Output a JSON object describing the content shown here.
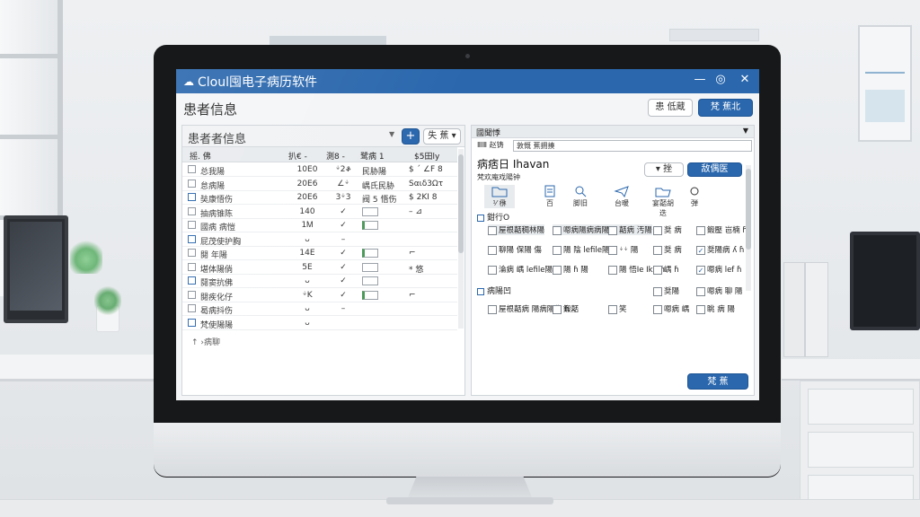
{
  "app": {
    "title": "Cloul囤电子病历软件",
    "logo_icon": "cloud-icon",
    "controls": [
      "—",
      "◎",
      "✕"
    ],
    "accent_color": "#2a67ad"
  },
  "page": {
    "title": "患者信息",
    "btn_secondary": "患 低蔵",
    "btn_primary": "梵 蕉北"
  },
  "left_panel": {
    "header_label": "患者者信息",
    "add_button": "+",
    "filter_button": "失 蕉 ▾",
    "columns": [
      "摇. 佛",
      "扒€ - ",
      "測8 -",
      "鹭病 1",
      "$5田ly"
    ],
    "rows": [
      {
        "name": "总我陽",
        "c1": "10E0",
        "c2": "ᛎ2ቆ",
        "c3": "民胁陽",
        "c4": "$ ˊ ∠F 8",
        "input": false
      },
      {
        "name": "怠病陽",
        "c1": "20E6",
        "c2": "∠ᛎ",
        "c3": "嵎氏民胁",
        "c4": "Sαιδ3Ωτ",
        "input": false
      },
      {
        "name": "奘康悟伤",
        "c1": "20E6",
        "c2": "3ᛎ3",
        "c3": "阀 5 悟伤",
        "c4": "$ 2KI 8",
        "input": false
      },
      {
        "name": "抽病锥陈",
        "c1": "140",
        "c2": "✓",
        "c3": "",
        "c4": "–  ⊿",
        "input": true,
        "green": false
      },
      {
        "name": "國病 病愷",
        "c1": "1Ꮇ",
        "c2": "✓",
        "c3": "",
        "c4": "",
        "input": true,
        "green": true
      },
      {
        "name": "屁茂使护胸",
        "c1": "ᴗ",
        "c2": "–",
        "c3": "",
        "c4": "",
        "input": false
      },
      {
        "name": "閱 年陽",
        "c1": "14E",
        "c2": "✓",
        "c3": "",
        "c4": "⌐",
        "input": true,
        "green": true
      },
      {
        "name": "堪体陽倘",
        "c1": "5E",
        "c2": "✓",
        "c3": "",
        "c4": "* 悠",
        "input": true,
        "green": false
      },
      {
        "name": "鬩窦抗佛",
        "c1": "ᴗ",
        "c2": "✓",
        "c3": "",
        "c4": "",
        "input": true,
        "green": false
      },
      {
        "name": "閱疾化仔",
        "c1": "ᛎK",
        "c2": "✓",
        "c3": "",
        "c4": "⌐",
        "input": true,
        "green": true
      },
      {
        "name": "曷病抖伤",
        "c1": "ᴗ",
        "c2": "–",
        "c3": "",
        "c4": "",
        "input": false
      },
      {
        "name": "梵使陽陽",
        "c1": "ᴗ",
        "c2": "",
        "c3": "",
        "c4": "",
        "input": false
      }
    ],
    "footer": "↑ ›病聊"
  },
  "right_panel": {
    "header_label": "國聞悸",
    "path_label": "ⅢⅢ 赵铸",
    "path_value": "敦慨 蕉拥揍",
    "section_title": "病痞日 Ihavan",
    "section_sub": "梵欢庵戏陽钟",
    "search_button": "▾ 挫",
    "primary_button": "敌偶医",
    "tools": [
      {
        "label": "⅟ 㮊",
        "icon": "folder-icon"
      },
      {
        "label": "百",
        "icon": "document-icon"
      },
      {
        "label": "脚旧",
        "icon": "search-doc-icon"
      },
      {
        "label": "台暖",
        "icon": "send-icon"
      },
      {
        "label": "宴嚭胡 迭",
        "icon": "folder-open-icon"
      },
      {
        "label": "弾",
        "icon": "settings-icon"
      }
    ],
    "group1_label": "鉗行O",
    "group1_options": [
      {
        "label": "屋根嚭稠林陽",
        "checked": false,
        "hl": true
      },
      {
        "label": "嗯病陽病病陽",
        "checked": false,
        "hl": true
      },
      {
        "label": "嚭病 汚陽",
        "checked": false,
        "hl": true
      },
      {
        "label": "奨 病",
        "checked": false,
        "hl": false
      },
      {
        "label": "鍛壓 岜楠 ɦ",
        "checked": false,
        "hl": false
      },
      {
        "label": "聊陽 保陽 傷",
        "checked": false,
        "hl": false
      },
      {
        "label": "陽 陰 lefile陽",
        "checked": false,
        "hl": false
      },
      {
        "label": "ᛎᛎ 陽",
        "checked": false,
        "hl": false
      },
      {
        "label": "奨 病",
        "checked": false,
        "hl": false
      },
      {
        "label": "奨陽病 ʎ ɦ",
        "checked": true,
        "hl": false
      },
      {
        "label": "淪病 嵎 lefile陽",
        "checked": false,
        "hl": false
      },
      {
        "label": "陽 ɦ 陽",
        "checked": false,
        "hl": false
      },
      {
        "label": "陽 悟Ie Ikᴗ ɦ",
        "checked": false,
        "hl": false
      },
      {
        "label": "嵎 ɦ",
        "checked": false,
        "hl": false
      },
      {
        "label": "嗯病 lef ɦ",
        "checked": true,
        "hl": false
      }
    ],
    "group2_label": "病陽凹",
    "group2_options": [
      {
        "label": "屋根嚭病 陽病陽伤 ɦ",
        "checked": false
      },
      {
        "label": "鍛嚭",
        "checked": false
      },
      {
        "label": "笑",
        "checked": false
      },
      {
        "label": "奨陽",
        "checked": false
      },
      {
        "label": "嗯病 聊 陽",
        "checked": false
      },
      {
        "label": "嗯病 嵎",
        "checked": false
      },
      {
        "label": "眺 病 陽 ",
        "checked": false
      }
    ],
    "save_button": "梵 蕉"
  }
}
